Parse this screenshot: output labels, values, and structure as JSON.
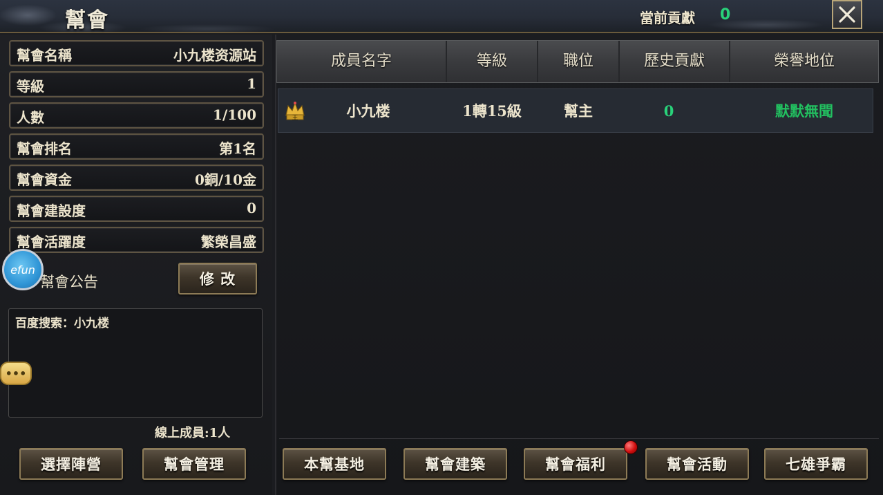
{
  "header": {
    "title": "幫會",
    "contribution_label": "當前貢獻",
    "contribution_value": "0"
  },
  "guild_info": [
    {
      "label": "幫會名稱",
      "value": "小九楼资源站"
    },
    {
      "label": "等級",
      "value": "1"
    },
    {
      "label": "人數",
      "value": "1/100"
    },
    {
      "label": "幫會排名",
      "value": "第1名"
    },
    {
      "label": "幫會資金",
      "value": "0銅/10金"
    },
    {
      "label": "幫會建設度",
      "value": "0"
    },
    {
      "label": "幫會活躍度",
      "value": "繁榮昌盛"
    }
  ],
  "notice": {
    "label": "幫會公告",
    "edit_button": "修 改",
    "text": "百度搜索：小九楼"
  },
  "overlay": {
    "logo_text": "efun",
    "chat_text": "•••"
  },
  "online_members": "線上成員:1人",
  "left_buttons": {
    "select_camp": "選擇陣營",
    "guild_manage": "幫會管理"
  },
  "table": {
    "headers": [
      "成員名字",
      "等級",
      "職位",
      "歷史貢獻",
      "榮譽地位"
    ],
    "rows": [
      {
        "name": "小九楼",
        "level": "1轉15級",
        "position": "幫主",
        "contribution": "0",
        "honor": "默默無聞",
        "badge": "王"
      }
    ]
  },
  "bottom_buttons": [
    "本幫基地",
    "幫會建築",
    "幫會福利",
    "幫會活動",
    "七雄爭霸"
  ],
  "colors": {
    "accent_green": "#29d27a",
    "honor_green": "#22c060",
    "button_border": "#8d7b56",
    "notification_red": "#d10e0e"
  }
}
